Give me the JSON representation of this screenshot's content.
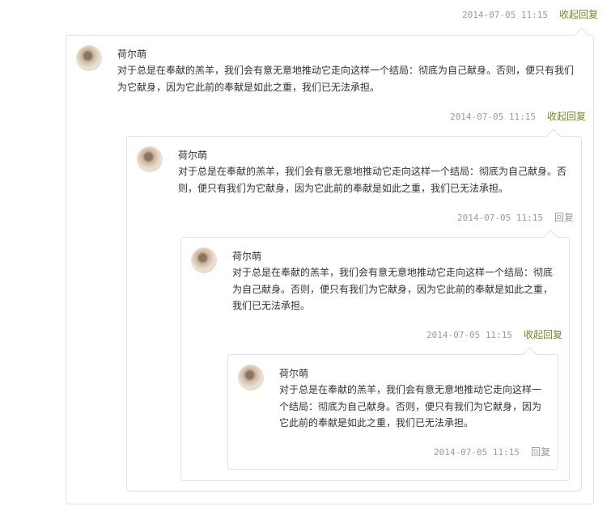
{
  "threads": [
    {
      "timestamp": "2014-07-05 11:15",
      "reply_label": "收起回复",
      "author": "荷尔萌",
      "content": "对于总是在奉献的羔羊，我们会有意无意地推动它走向这样一个结局：彻底为自己献身。否则，便只有我们为它献身，因为它此前的奉献是如此之重，我们已无法承担。"
    },
    {
      "timestamp": "2014-07-05 11:15",
      "reply_label": "收起回复",
      "author": "荷尔萌",
      "content": "对于总是在奉献的羔羊，我们会有意无意地推动它走向这样一个结局：彻底为自己献身。否则，便只有我们为它献身，因为它此前的奉献是如此之重，我们已无法承担。"
    },
    {
      "timestamp": "2014-07-05 11:15",
      "reply_label": "回复",
      "author": "荷尔萌",
      "content": "对于总是在奉献的羔羊，我们会有意无意地推动它走向这样一个结局：彻底为自己献身。否则，便只有我们为它献身，因为它此前的奉献是如此之重，我们已无法承担。"
    },
    {
      "timestamp": "2014-07-05 11:15",
      "reply_label": "收起回复",
      "author": "荷尔萌",
      "content": "对于总是在奉献的羔羊，我们会有意无意地推动它走向这样一个结局：彻底为自己献身。否则，便只有我们为它献身，因为它此前的奉献是如此之重，我们已无法承担。"
    },
    {
      "timestamp": "2014-07-05 11:15",
      "reply_label": "回复",
      "author": "荷尔萌",
      "content": ""
    }
  ],
  "colors": {
    "reply_link": "#6b8e23",
    "reply_plain": "#999999",
    "border": "#e2e2e2"
  }
}
